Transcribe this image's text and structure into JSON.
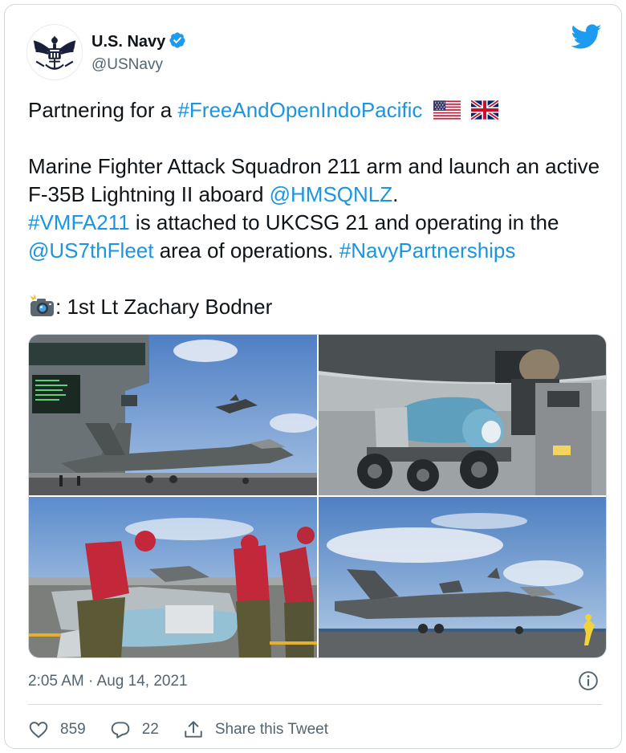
{
  "author": {
    "display_name": "U.S. Navy",
    "handle": "@USNavy",
    "verified": true
  },
  "tweet": {
    "line1_prefix": "Partnering for a ",
    "line1_hashtag": "#FreeAndOpenIndoPacific",
    "flags": [
      "us-flag-icon",
      "uk-flag-icon"
    ],
    "p2_text1": "Marine Fighter Attack Squadron 211 arm and launch an active F-35B Lightning II aboard ",
    "p2_mention1": "@HMSQNLZ",
    "p2_text2": ". ",
    "p2_hashtag1": "#VMFA211",
    "p2_text3": " is attached to UKCSG 21 and operating in the ",
    "p2_mention2": "@US7thFleet",
    "p2_text4": " area of operations. ",
    "p2_hashtag2": "#NavyPartnerships",
    "credit_text": ": 1st Lt Zachary Bodner"
  },
  "photos": [
    {
      "icon": "photo-f35-flight-deck"
    },
    {
      "icon": "photo-munition-cart"
    },
    {
      "icon": "photo-crew-loading"
    },
    {
      "icon": "photo-f35-takeoff"
    }
  ],
  "footer": {
    "timestamp": "2:05 AM · Aug 14, 2021",
    "likes": "859",
    "replies": "22",
    "share_label": "Share this Tweet"
  },
  "colors": {
    "link": "#1b95e0",
    "twitter_blue": "#1d9bf0",
    "muted": "#536471",
    "border": "#cfd9de"
  }
}
